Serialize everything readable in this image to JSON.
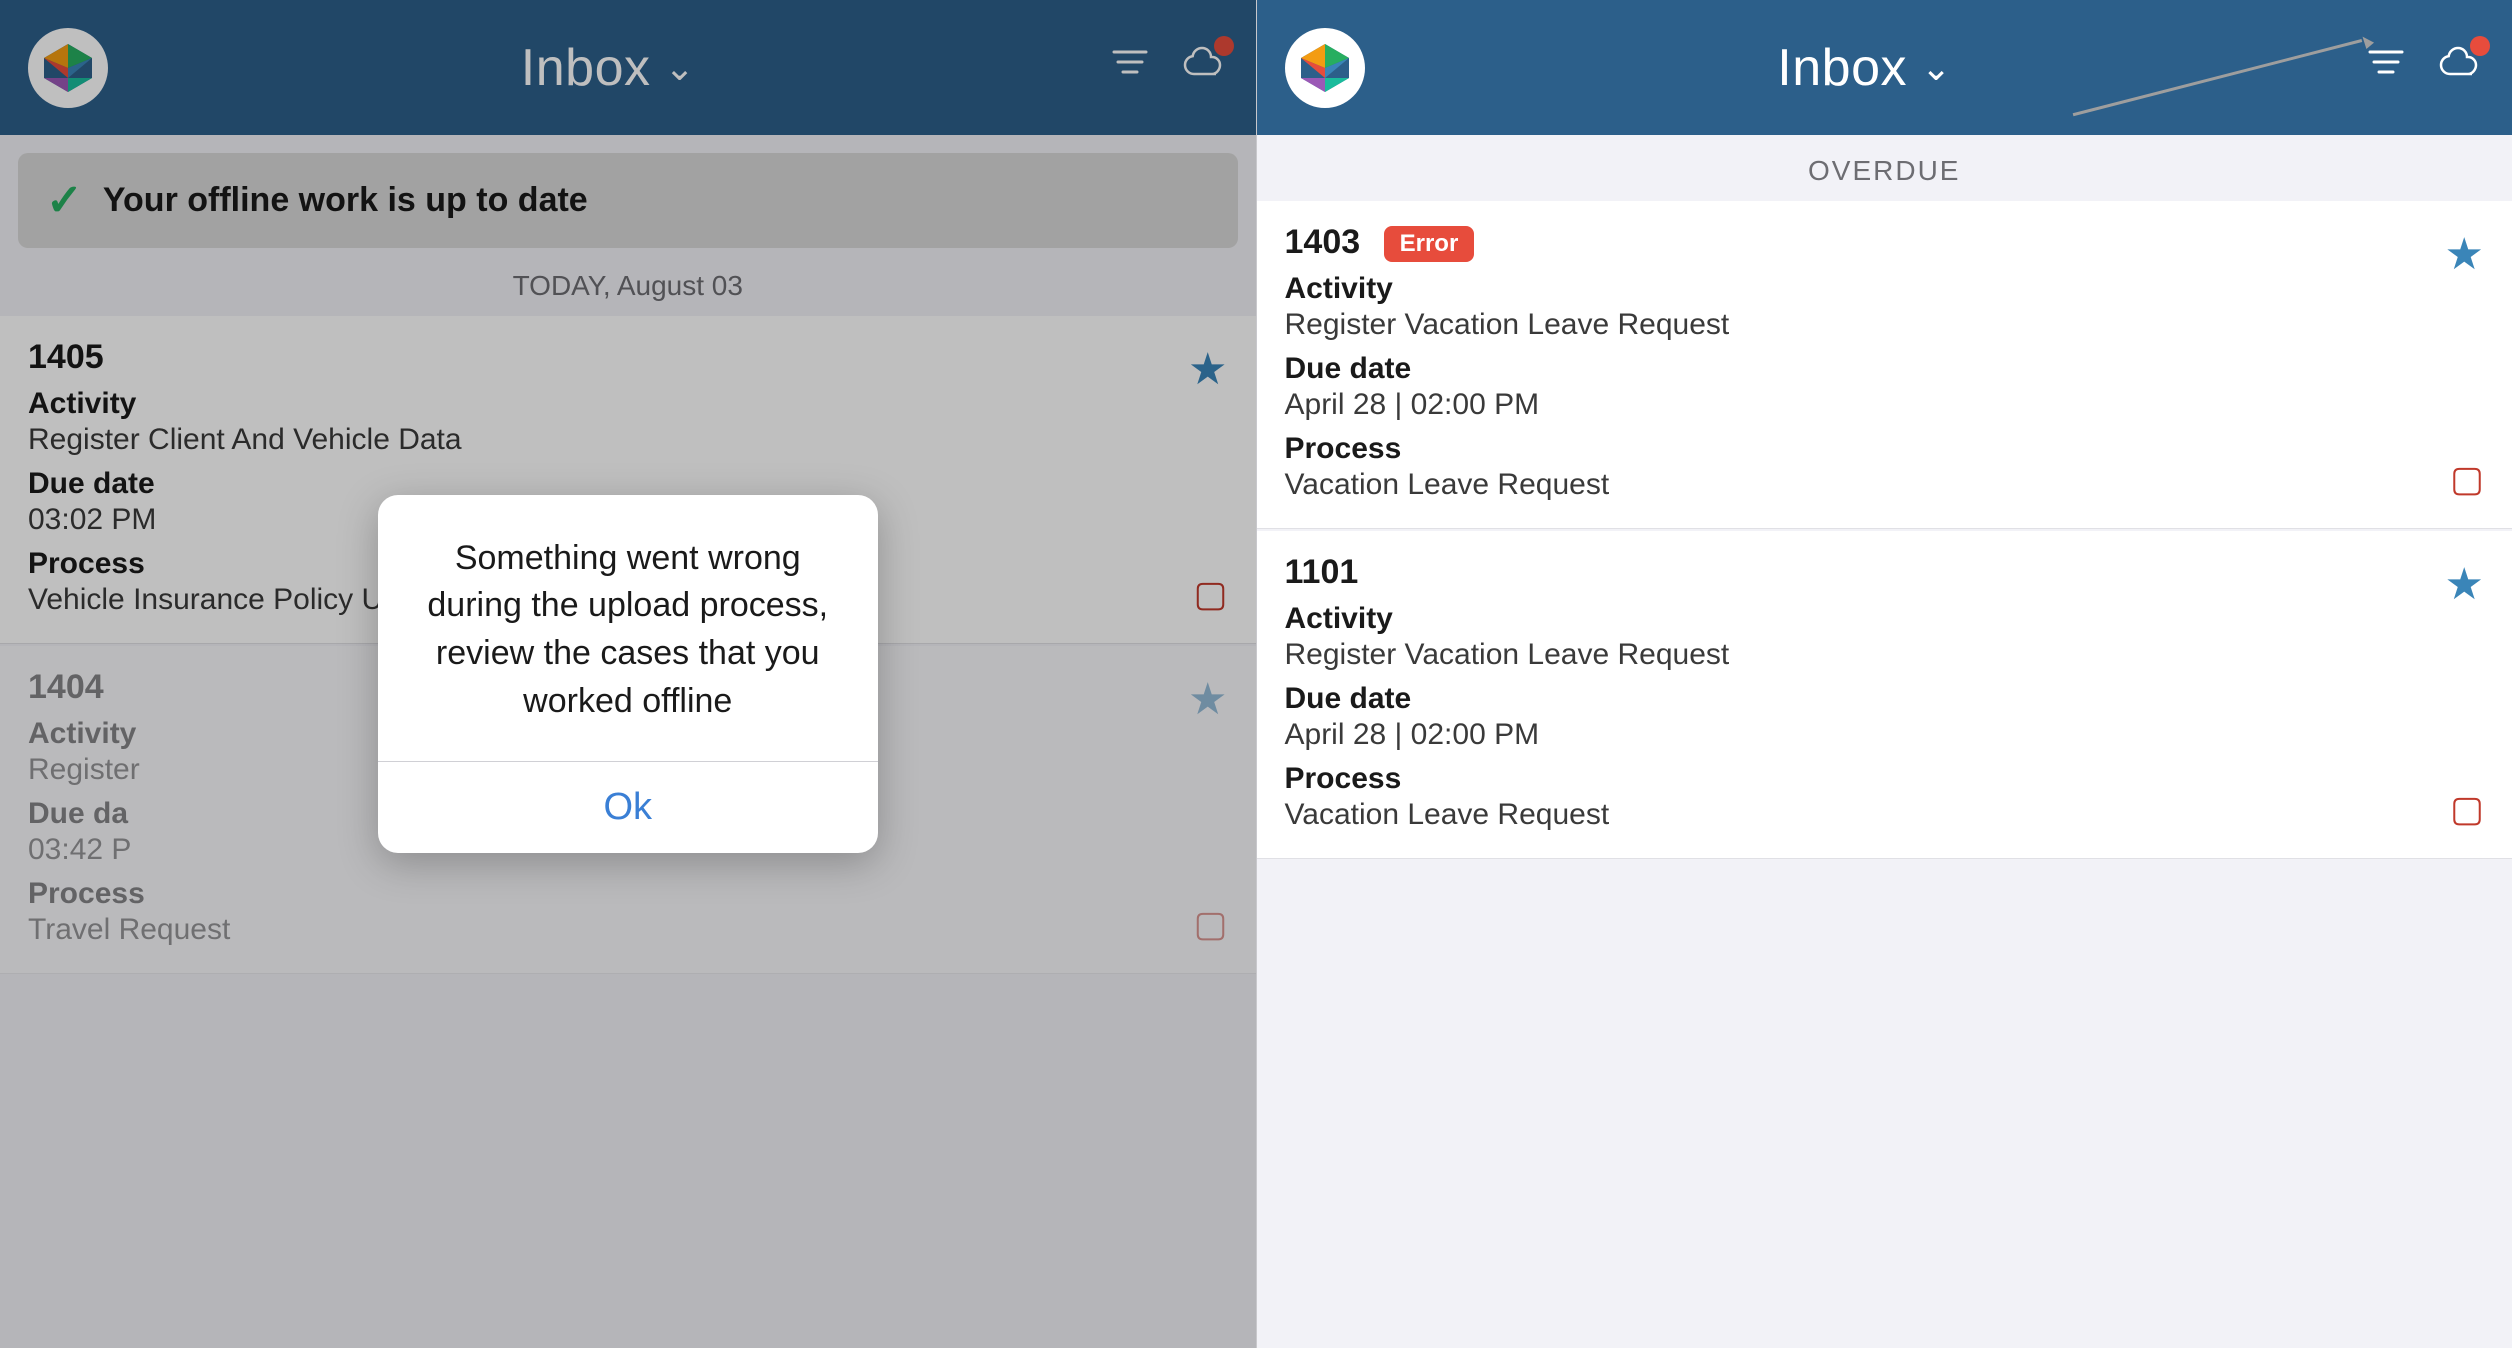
{
  "left_panel": {
    "header": {
      "title": "Inbox",
      "chevron": "∨",
      "logo_alt": "App Logo",
      "filter_icon": "filter",
      "cloud_icon": "cloud"
    },
    "offline_banner": {
      "text": "Your offline work is up to date"
    },
    "date_separator": "TODAY, August 03",
    "items": [
      {
        "id": "1405",
        "activity_label": "Activity",
        "activity_value": "Register Client And Vehicle Data",
        "due_date_label": "Due date",
        "due_date_value": "03:02 PM",
        "process_label": "Process",
        "process_value": "Vehicle Insurance Policy Underwriting",
        "starred": true
      },
      {
        "id": "1404",
        "activity_label": "Activity",
        "activity_value": "Register",
        "due_date_label": "Due da",
        "due_date_value": "03:42 P",
        "process_label": "Process",
        "process_value": "Travel Request",
        "starred": true
      }
    ],
    "dialog": {
      "message": "Something went wrong during the upload process, review the cases that you worked offline",
      "button_label": "Ok"
    }
  },
  "right_panel": {
    "header": {
      "title": "Inbox",
      "chevron": "∨",
      "logo_alt": "App Logo",
      "filter_icon": "filter",
      "cloud_icon": "cloud"
    },
    "section_header": "OVERDUE",
    "items": [
      {
        "id": "1403",
        "has_error": true,
        "error_label": "Error",
        "activity_label": "Activity",
        "activity_value": "Register Vacation Leave Request",
        "due_date_label": "Due date",
        "due_date_value": "April 28 | 02:00 PM",
        "process_label": "Process",
        "process_value": "Vacation Leave Request",
        "starred": true
      },
      {
        "id": "1101",
        "has_error": false,
        "activity_label": "Activity",
        "activity_value": "Register Vacation Leave Request",
        "due_date_label": "Due date",
        "due_date_value": "April 28 | 02:00 PM",
        "process_label": "Process",
        "process_value": "Vacation Leave Request",
        "starred": true
      }
    ]
  },
  "colors": {
    "header_bg": "#2c5f8a",
    "star_color": "#3a85b8",
    "error_badge_bg": "#e74c3c",
    "ok_button_color": "#3a7fd5",
    "check_color": "#27ae60"
  }
}
